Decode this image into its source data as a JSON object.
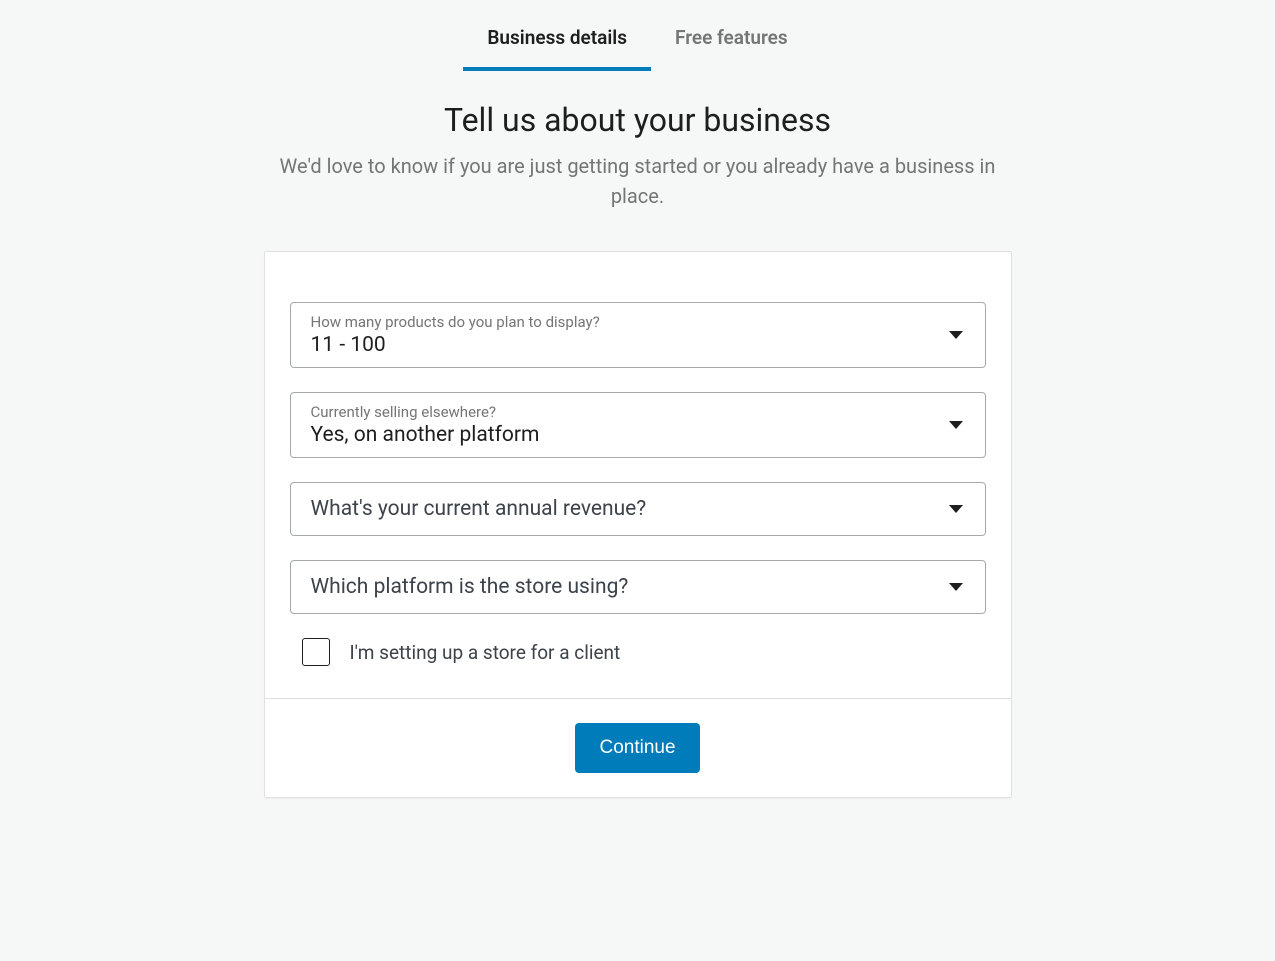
{
  "tabs": {
    "business": "Business details",
    "features": "Free features"
  },
  "header": {
    "title": "Tell us about your business",
    "subtitle": "We'd love to know if you are just getting started or you already have a business in place."
  },
  "form": {
    "products": {
      "label": "How many products do you plan to display?",
      "value": "11 - 100"
    },
    "elsewhere": {
      "label": "Currently selling elsewhere?",
      "value": "Yes, on another platform"
    },
    "revenue": {
      "placeholder": "What's your current annual revenue?"
    },
    "platform": {
      "placeholder": "Which platform is the store using?"
    },
    "client_checkbox": {
      "label": "I'm setting up a store for a client"
    },
    "continue": "Continue"
  }
}
